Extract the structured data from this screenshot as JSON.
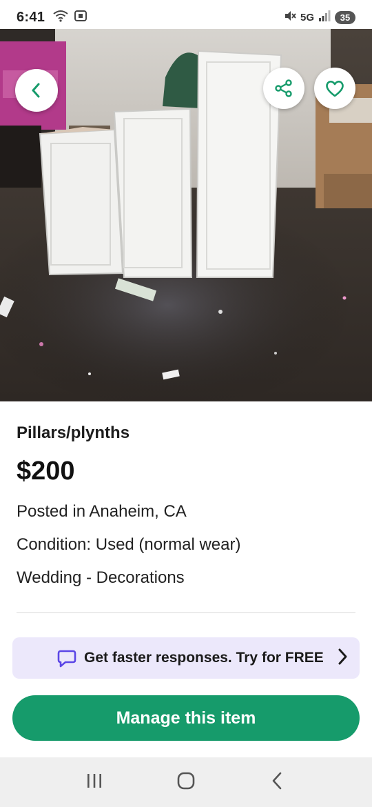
{
  "status_bar": {
    "time": "6:41",
    "network": "5G",
    "battery": "35",
    "icons": [
      "wifi-icon",
      "screenshot-icon",
      "mute-icon",
      "signal-icon"
    ]
  },
  "listing": {
    "title": "Pillars/plynths",
    "price": "$200",
    "location": "Posted in Anaheim, CA",
    "condition": "Condition: Used (normal wear)",
    "category": "Wedding - Decorations"
  },
  "promo": {
    "text": "Get faster responses. Try for FREE",
    "icon": "chat-bubble-icon"
  },
  "actions": {
    "manage_label": "Manage this item"
  },
  "colors": {
    "accent_green": "#169b6b",
    "promo_bg": "#ece8fb",
    "promo_icon": "#5b46e6"
  }
}
